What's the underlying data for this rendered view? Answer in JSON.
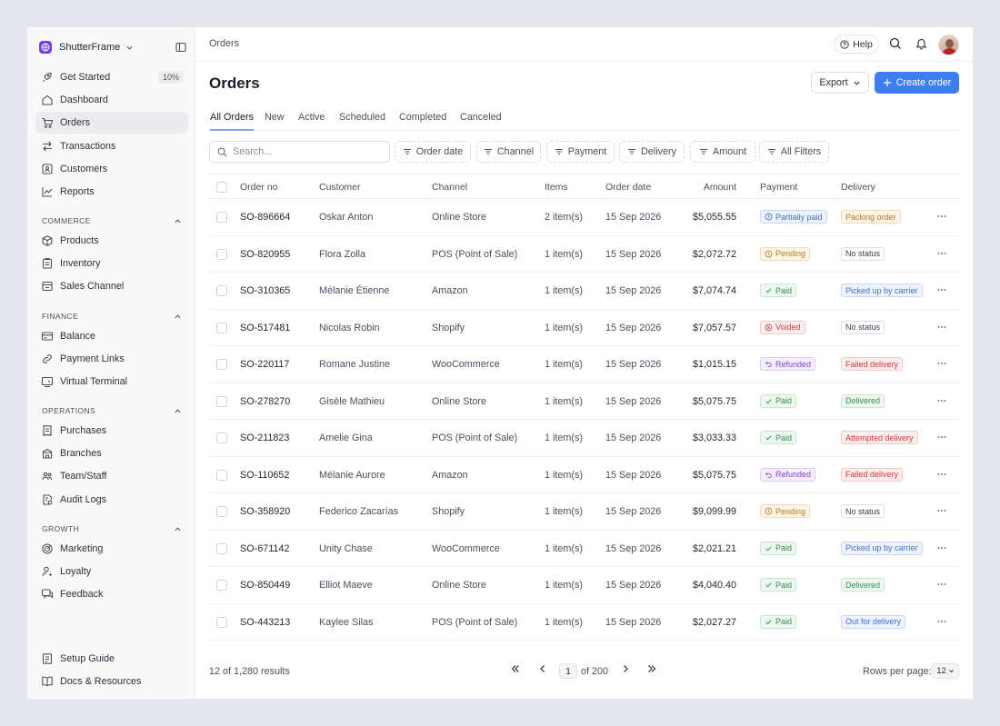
{
  "colors": {
    "accent": "#3d7ff2",
    "brand": "#6d3df5"
  },
  "brand": {
    "name": "ShutterFrame",
    "logo_icon": "globe-icon"
  },
  "sidebar": {
    "main_items": [
      {
        "label": "Get Started",
        "icon": "rocket-icon",
        "badge": "10%"
      },
      {
        "label": "Dashboard",
        "icon": "home-icon"
      },
      {
        "label": "Orders",
        "icon": "cart-icon",
        "active": true
      },
      {
        "label": "Transactions",
        "icon": "arrows-icon"
      },
      {
        "label": "Customers",
        "icon": "user-card-icon"
      },
      {
        "label": "Reports",
        "icon": "chart-icon"
      }
    ],
    "sections": [
      {
        "title": "COMMERCE",
        "items": [
          {
            "label": "Products",
            "icon": "box-icon"
          },
          {
            "label": "Inventory",
            "icon": "clipboard-icon"
          },
          {
            "label": "Sales Channel",
            "icon": "store-icon"
          }
        ]
      },
      {
        "title": "FINANCE",
        "items": [
          {
            "label": "Balance",
            "icon": "card-icon"
          },
          {
            "label": "Payment Links",
            "icon": "link-icon"
          },
          {
            "label": "Virtual Terminal",
            "icon": "terminal-icon"
          }
        ]
      },
      {
        "title": "OPERATIONS",
        "items": [
          {
            "label": "Purchases",
            "icon": "receipt-icon"
          },
          {
            "label": "Branches",
            "icon": "building-icon"
          },
          {
            "label": "Team/Staff",
            "icon": "team-icon"
          },
          {
            "label": "Audit Logs",
            "icon": "log-icon"
          }
        ]
      },
      {
        "title": "GROWTH",
        "items": [
          {
            "label": "Marketing",
            "icon": "target-icon"
          },
          {
            "label": "Loyalty",
            "icon": "user-gear-icon"
          },
          {
            "label": "Feedback",
            "icon": "chat-icon"
          }
        ]
      }
    ],
    "bottom_items": [
      {
        "label": "Setup Guide",
        "icon": "guide-icon"
      },
      {
        "label": "Docs & Resources",
        "icon": "book-icon"
      }
    ]
  },
  "topbar": {
    "breadcrumb": "Orders",
    "help_label": "Help"
  },
  "page": {
    "title": "Orders",
    "export_label": "Export",
    "create_label": "Create order"
  },
  "tabs": [
    "All Orders",
    "New",
    "Active",
    "Scheduled",
    "Completed",
    "Canceled"
  ],
  "search": {
    "placeholder": "Search...",
    "value": ""
  },
  "filters": [
    "Order date",
    "Channel",
    "Payment",
    "Delivery",
    "Amount",
    "All Filters"
  ],
  "table": {
    "headers": [
      "Order no",
      "Customer",
      "Channel",
      "Items",
      "Order date",
      "Amount",
      "Payment",
      "Delivery"
    ],
    "rows": [
      {
        "order": "SO-896664",
        "customer": "Oskar Anton",
        "channel": "Online Store",
        "items": "2 item(s)",
        "date": "15 Sep 2026",
        "amount": "$5,055.55",
        "payment": "Partially paid",
        "delivery": "Packing order"
      },
      {
        "order": "SO-820955",
        "customer": "Flora Zolla",
        "channel": "POS (Point of Sale)",
        "items": "1 item(s)",
        "date": "15 Sep 2026",
        "amount": "$2,072.72",
        "payment": "Pending",
        "delivery": "No status"
      },
      {
        "order": "SO-310365",
        "customer": "Mélanie Étienne",
        "channel": "Amazon",
        "items": "1 item(s)",
        "date": "15 Sep 2026",
        "amount": "$7,074.74",
        "payment": "Paid",
        "delivery": "Picked up by carrier"
      },
      {
        "order": "SO-517481",
        "customer": "Nicolas Robin",
        "channel": "Shopify",
        "items": "1 item(s)",
        "date": "15 Sep 2026",
        "amount": "$7,057.57",
        "payment": "Voided",
        "delivery": "No status"
      },
      {
        "order": "SO-220117",
        "customer": "Romane Justine",
        "channel": "WooCommerce",
        "items": "1 item(s)",
        "date": "15 Sep 2026",
        "amount": "$1,015.15",
        "payment": "Refunded",
        "delivery": "Failed delivery"
      },
      {
        "order": "SO-278270",
        "customer": "Gisèle Mathieu",
        "channel": "Online Store",
        "items": "1 item(s)",
        "date": "15 Sep 2026",
        "amount": "$5,075.75",
        "payment": "Paid",
        "delivery": "Delivered"
      },
      {
        "order": "SO-211823",
        "customer": "Amelie Gina",
        "channel": "POS (Point of Sale)",
        "items": "1 item(s)",
        "date": "15 Sep 2026",
        "amount": "$3,033.33",
        "payment": "Paid",
        "delivery": "Attempted delivery"
      },
      {
        "order": "SO-110652",
        "customer": "Mélanie Aurore",
        "channel": "Amazon",
        "items": "1 item(s)",
        "date": "15 Sep 2026",
        "amount": "$5,075.75",
        "payment": "Refunded",
        "delivery": "Failed delivery"
      },
      {
        "order": "SO-358920",
        "customer": "Federico Zacarías",
        "channel": "Shopify",
        "items": "1 item(s)",
        "date": "15 Sep 2026",
        "amount": "$9,099.99",
        "payment": "Pending",
        "delivery": "No status"
      },
      {
        "order": "SO-671142",
        "customer": "Unity Chase",
        "channel": "WooCommerce",
        "items": "1 item(s)",
        "date": "15 Sep 2026",
        "amount": "$2,021.21",
        "payment": "Paid",
        "delivery": "Picked up by carrier"
      },
      {
        "order": "SO-850449",
        "customer": "Elliot Maeve",
        "channel": "Online Store",
        "items": "1 item(s)",
        "date": "15 Sep 2026",
        "amount": "$4,040.40",
        "payment": "Paid",
        "delivery": "Delivered"
      },
      {
        "order": "SO-443213",
        "customer": "Kaylee Silas",
        "channel": "POS (Point of Sale)",
        "items": "1 item(s)",
        "date": "15 Sep 2026",
        "amount": "$2,027.27",
        "payment": "Paid",
        "delivery": "Out for delivery"
      }
    ]
  },
  "status_colors": {
    "Partially paid": {
      "fg": "#3b6fd4",
      "bg": "#eef3fd",
      "border": "#c9d8f6",
      "icon": "clock-icon"
    },
    "Pending": {
      "fg": "#b7791f",
      "bg": "#fdf6e8",
      "border": "#f1ddb3",
      "icon": "clock-icon"
    },
    "Paid": {
      "fg": "#2f8f4e",
      "bg": "#eef8f1",
      "border": "#c7e7d1",
      "icon": "check-icon"
    },
    "Voided": {
      "fg": "#d0393a",
      "bg": "#fdeeee",
      "border": "#f4c9c9",
      "icon": "x-circle-icon"
    },
    "Refunded": {
      "fg": "#8a3fd0",
      "bg": "#f5eefd",
      "border": "#dfccf4",
      "icon": "undo-icon"
    },
    "Packing order": {
      "fg": "#b7791f",
      "bg": "#fdf6e8",
      "border": "#f1ddb3"
    },
    "No status": {
      "fg": "#3a3f4b",
      "bg": "#ffffff",
      "border": "#dedee3"
    },
    "Picked up by carrier": {
      "fg": "#3b6fd4",
      "bg": "#eef3fd",
      "border": "#c9d8f6"
    },
    "Failed delivery": {
      "fg": "#d0393a",
      "bg": "#fdeeee",
      "border": "#f4c9c9"
    },
    "Delivered": {
      "fg": "#2f8f4e",
      "bg": "#eef8f1",
      "border": "#c7e7d1"
    },
    "Attempted delivery": {
      "fg": "#d0393a",
      "bg": "#fdeeee",
      "border": "#f4c9c9"
    },
    "Out for delivery": {
      "fg": "#3b6fd4",
      "bg": "#eef3fd",
      "border": "#c9d8f6"
    }
  },
  "footer": {
    "results": "12 of 1,280 results",
    "current_page": "1",
    "page_of": "of 200",
    "rows_per_page_label": "Rows per page:",
    "rows_per_page": "12"
  }
}
